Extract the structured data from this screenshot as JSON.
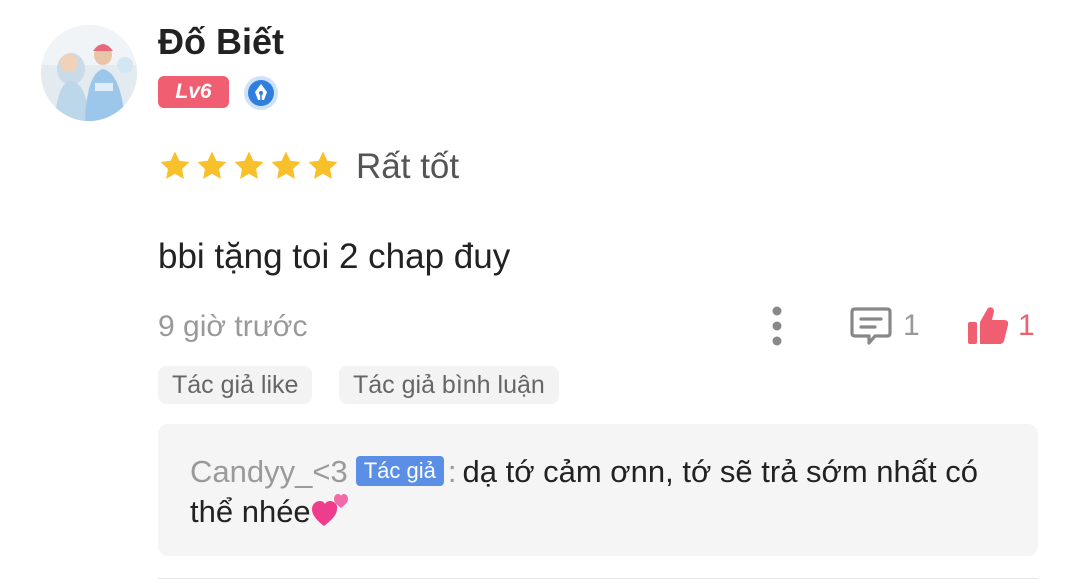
{
  "review": {
    "username": "Đố Biết",
    "level": "Lv6",
    "rating": 5,
    "rating_max": 5,
    "rating_label": "Rất tốt",
    "text": "bbi tặng toi 2 chap đuy",
    "time": "9 giờ trước",
    "comment_count": "1",
    "like_count": "1"
  },
  "tags": {
    "author_like": "Tác giả like",
    "author_comment": "Tác giả bình luận"
  },
  "reply": {
    "author": "Candyy_<3",
    "author_badge": "Tác giả",
    "separator": ":",
    "text": "dạ tớ cảm ơnn, tớ sẽ trả sớm nhất có thể nhée"
  },
  "icons": {
    "avatar": "user-avatar",
    "verify": "pen-nib-badge-icon",
    "star": "star-icon",
    "more": "more-vertical-icon",
    "comment": "comment-icon",
    "like": "thumbs-up-icon",
    "heart": "two-hearts-icon"
  },
  "colors": {
    "level_badge": "#ef5e71",
    "star": "#f8c02a",
    "like": "#ef5e71",
    "author_badge": "#5b8fe6",
    "verify_badge": "#2f7fe0"
  }
}
